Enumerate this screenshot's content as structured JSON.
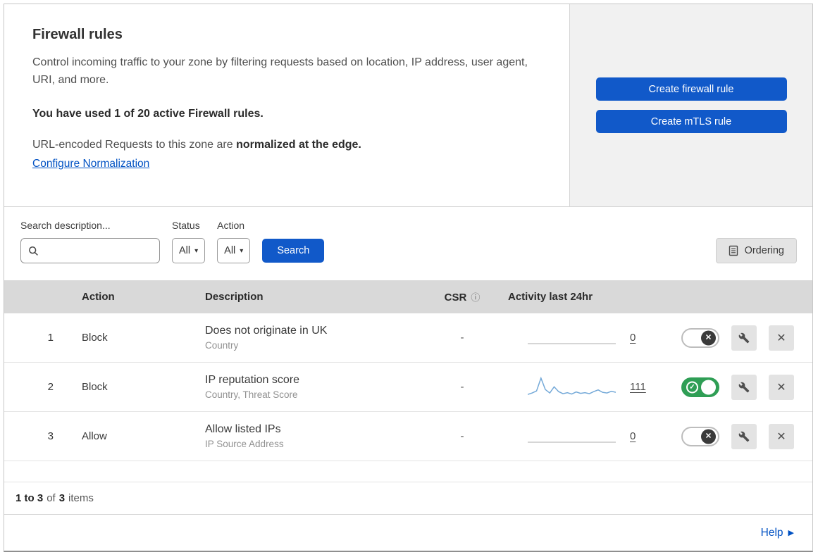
{
  "icons": {
    "caret": "▾",
    "x": "✕",
    "check": "✓",
    "info": "ⓘ",
    "help_arrow": "▶"
  },
  "colors": {
    "primary_blue": "#1159c9",
    "link_blue": "#0051c3",
    "toggle_green": "#2f9e55",
    "sparkline_blue": "#74a9d8"
  },
  "header": {
    "title": "Firewall rules",
    "description": "Control incoming traffic to your zone by filtering requests based on location, IP address, user agent, URI, and more.",
    "usage": "You have used 1 of 20 active Firewall rules.",
    "normalization_prefix": "URL-encoded Requests to this zone are ",
    "normalization_bold": "normalized at the edge.",
    "normalization_link": "Configure Normalization",
    "buttons": {
      "create_firewall_rule": "Create firewall rule",
      "create_mtls_rule": "Create mTLS rule"
    }
  },
  "filters": {
    "search_label": "Search description...",
    "status_label": "Status",
    "status_value": "All",
    "action_label": "Action",
    "action_value": "All",
    "search_button": "Search",
    "ordering_button": "Ordering"
  },
  "table": {
    "columns": {
      "action": "Action",
      "description": "Description",
      "csr": "CSR",
      "activity": "Activity last 24hr"
    },
    "rows": [
      {
        "priority": "1",
        "action": "Block",
        "description": "Does not originate in UK",
        "criteria": "Country",
        "csr": "-",
        "activity_count": "0",
        "enabled": false,
        "sparkline": [
          0
        ]
      },
      {
        "priority": "2",
        "action": "Block",
        "description": "IP reputation score",
        "criteria": "Country, Threat Score",
        "csr": "-",
        "activity_count": "111",
        "enabled": true,
        "sparkline": [
          8,
          12,
          18,
          55,
          22,
          12,
          30,
          16,
          10,
          13,
          9,
          15,
          11,
          13,
          10,
          16,
          21,
          14,
          12,
          17,
          14
        ]
      },
      {
        "priority": "3",
        "action": "Allow",
        "description": "Allow listed IPs",
        "criteria": "IP Source Address",
        "csr": "-",
        "activity_count": "0",
        "enabled": false,
        "sparkline": [
          0
        ]
      }
    ],
    "footer": {
      "range": "1 to 3",
      "of": "of",
      "total": "3",
      "items": "items"
    }
  },
  "help": {
    "label": "Help"
  }
}
